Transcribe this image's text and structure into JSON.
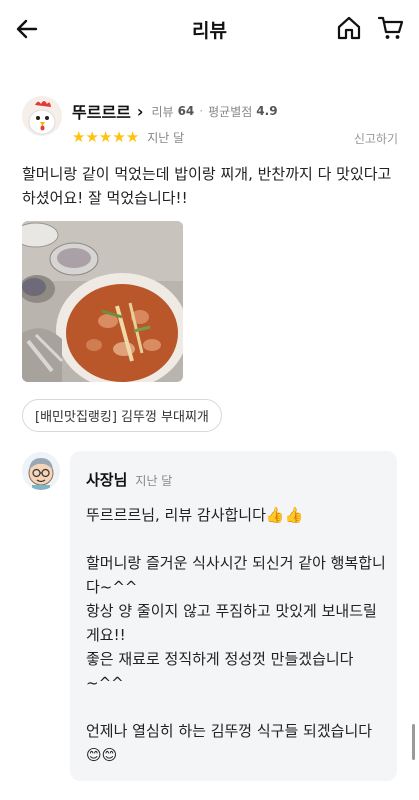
{
  "header": {
    "title": "리뷰",
    "back_icon": "arrow-left-icon",
    "home_icon": "home-icon",
    "cart_icon": "cart-icon"
  },
  "review": {
    "nickname": "뚜르르르",
    "review_count_label": "리뷰",
    "review_count": "64",
    "avg_rating_label": "평균별점",
    "avg_rating": "4.9",
    "stars": 5,
    "date": "지난 달",
    "report_label": "신고하기",
    "text": "할머니랑 같이 먹었는데 밥이랑 찌개, 반찬까지 다 맛있다고 하셨어요! 잘 먹었습니다!!",
    "photo_alt": "부대찌개 음식 사진",
    "menu_tag": "[배민맛집랭킹] 김뚜껑 부대찌개"
  },
  "reply": {
    "name": "사장님",
    "date": "지난 달",
    "text": "뚜르르르님, 리뷰 감사합니다👍👍\n\n할머니랑 즐거운 식사시간 되신거 같아 행복합니다~^^\n항상 양 줄이지 않고 푸짐하고 맛있게 보내드릴게요!!\n좋은 재료로 정직하게 정성껏 만들겠습니다~^^\n\n언제나 열심히 하는 김뚜껑 식구들 되겠습니다😊😊"
  },
  "colors": {
    "star": "#ffc20e",
    "reply_bg": "#f4f5f7",
    "tag_border": "#d8d8d8"
  }
}
